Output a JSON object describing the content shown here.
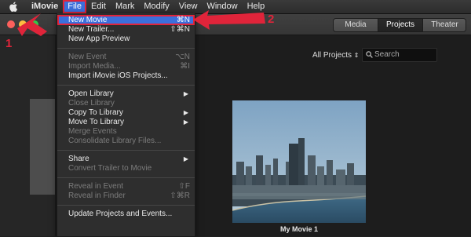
{
  "menubar": {
    "app_name": "iMovie",
    "items": [
      "File",
      "Edit",
      "Mark",
      "Modify",
      "View",
      "Window",
      "Help"
    ]
  },
  "toolbar": {
    "segments": [
      "Media",
      "Projects",
      "Theater"
    ],
    "selected_segment": "Projects"
  },
  "browser": {
    "filter_label": "All Projects",
    "search_placeholder": "Search",
    "movie_title": "My Movie 1"
  },
  "file_menu": {
    "new_movie": {
      "label": "New Movie",
      "shortcut": "⌘N"
    },
    "new_trailer": {
      "label": "New Trailer...",
      "shortcut": "⇧⌘N"
    },
    "new_app_preview": {
      "label": "New App Preview"
    },
    "new_event": {
      "label": "New Event",
      "shortcut": "⌥N"
    },
    "import_media": {
      "label": "Import Media...",
      "shortcut": "⌘I"
    },
    "import_ios": {
      "label": "Import iMovie iOS Projects..."
    },
    "open_library": {
      "label": "Open Library"
    },
    "close_library": {
      "label": "Close Library"
    },
    "copy_to_library": {
      "label": "Copy To Library"
    },
    "move_to_library": {
      "label": "Move To Library"
    },
    "merge_events": {
      "label": "Merge Events"
    },
    "consolidate": {
      "label": "Consolidate Library Files..."
    },
    "share": {
      "label": "Share"
    },
    "convert_trailer": {
      "label": "Convert Trailer to Movie"
    },
    "reveal_event": {
      "label": "Reveal in Event",
      "shortcut": "⇧F"
    },
    "reveal_finder": {
      "label": "Reveal in Finder",
      "shortcut": "⇧⌘R"
    },
    "update_projects": {
      "label": "Update Projects and Events..."
    }
  },
  "annotations": {
    "step1": "1",
    "step2": "2"
  },
  "colors": {
    "highlight": "#3b6fdc",
    "annotation": "#e0243a"
  }
}
